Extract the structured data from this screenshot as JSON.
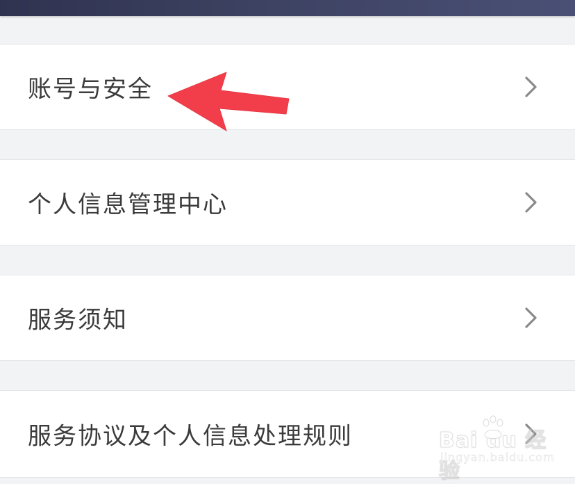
{
  "menu": {
    "items": [
      {
        "label": "账号与安全",
        "icon": "chevron-right-icon"
      },
      {
        "label": "个人信息管理中心",
        "icon": "chevron-right-icon"
      },
      {
        "label": "服务须知",
        "icon": "chevron-right-icon"
      },
      {
        "label": "服务协议及个人信息处理规则",
        "icon": "chevron-right-icon"
      }
    ]
  },
  "annotation": {
    "arrow_color": "#f23e4a",
    "points_to": "账号与安全"
  },
  "watermark": {
    "brand": "Bai du 经验",
    "url": "jingyan.baidu.com"
  },
  "colors": {
    "background": "#f2f3f5",
    "row_background": "#ffffff",
    "label_text": "#3b3b3b",
    "chevron": "#8a8a8a",
    "header_bar": "#3d4262"
  }
}
